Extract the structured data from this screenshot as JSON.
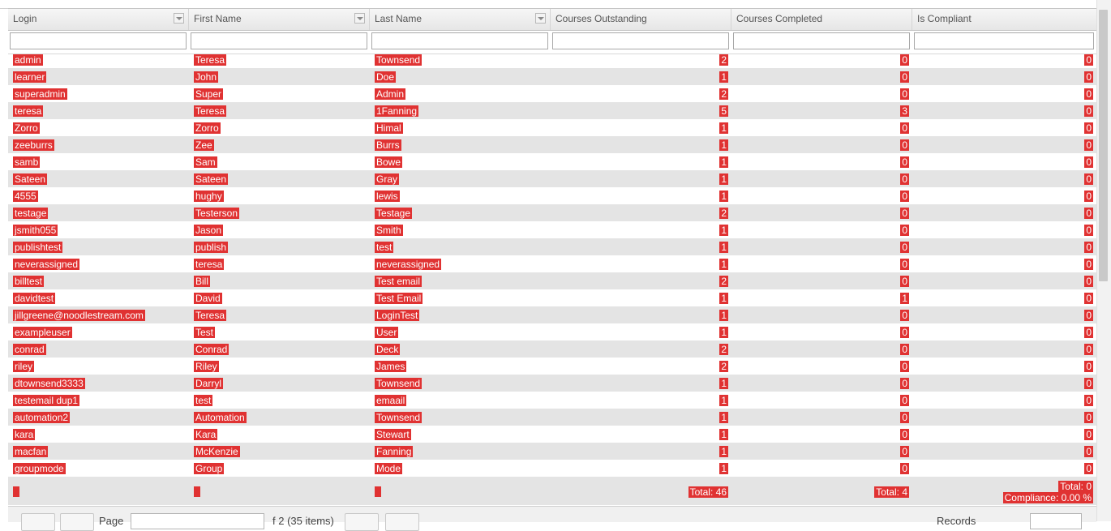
{
  "columns": [
    {
      "label": "Login",
      "has_menu": true
    },
    {
      "label": "First Name",
      "has_menu": true
    },
    {
      "label": "Last Name",
      "has_menu": true
    },
    {
      "label": "Courses Outstanding",
      "has_menu": false
    },
    {
      "label": "Courses Completed",
      "has_menu": false
    },
    {
      "label": "Is Compliant",
      "has_menu": false
    }
  ],
  "rows": [
    [
      "admin",
      "Teresa",
      "Townsend",
      "2",
      "0",
      "0"
    ],
    [
      "learner",
      "John",
      "Doe",
      "1",
      "0",
      "0"
    ],
    [
      "superadmin",
      "Super",
      "Admin",
      "2",
      "0",
      "0"
    ],
    [
      "teresa",
      "Teresa",
      "1Fanning",
      "5",
      "3",
      "0"
    ],
    [
      "Zorro",
      "Zorro",
      "Himal",
      "1",
      "0",
      "0"
    ],
    [
      "zeeburrs",
      "Zee",
      "Burrs",
      "1",
      "0",
      "0"
    ],
    [
      "samb",
      "Sam",
      "Bowe",
      "1",
      "0",
      "0"
    ],
    [
      "Sateen",
      "Sateen",
      "Gray",
      "1",
      "0",
      "0"
    ],
    [
      "4555",
      "hughy",
      "lewis",
      "1",
      "0",
      "0"
    ],
    [
      "testage",
      "Testerson",
      "Testage",
      "2",
      "0",
      "0"
    ],
    [
      "jsmith055",
      "Jason",
      "Smith",
      "1",
      "0",
      "0"
    ],
    [
      "publishtest",
      "publish",
      "test",
      "1",
      "0",
      "0"
    ],
    [
      "neverassigned",
      "teresa",
      "neverassigned",
      "1",
      "0",
      "0"
    ],
    [
      "billtest",
      "Bill",
      "Test email",
      "2",
      "0",
      "0"
    ],
    [
      "davidtest",
      "David",
      "Test Email",
      "1",
      "1",
      "0"
    ],
    [
      "jillgreene@noodlestream.com",
      "Teresa",
      "LoginTest",
      "1",
      "0",
      "0"
    ],
    [
      "exampleuser",
      "Test",
      "User",
      "1",
      "0",
      "0"
    ],
    [
      "conrad",
      "Conrad",
      "Deck",
      "2",
      "0",
      "0"
    ],
    [
      "riley",
      "Riley",
      "James",
      "2",
      "0",
      "0"
    ],
    [
      "dtownsend3333",
      "Darryl",
      "Townsend",
      "1",
      "0",
      "0"
    ],
    [
      "testemail dup1",
      "test",
      "emaail",
      "1",
      "0",
      "0"
    ],
    [
      "automation2",
      "Automation",
      "Townsend",
      "1",
      "0",
      "0"
    ],
    [
      "kara",
      "Kara",
      "Stewart",
      "1",
      "0",
      "0"
    ],
    [
      "macfan",
      "McKenzie",
      "Fanning",
      "1",
      "0",
      "0"
    ],
    [
      "groupmode",
      "Group",
      "Mode",
      "1",
      "0",
      "0"
    ]
  ],
  "footer": {
    "outstanding_total": "Total: 46",
    "completed_total": "Total: 4",
    "compliant_total": "Total: 0",
    "compliance": "Compliance: 0.00 %"
  },
  "pager": {
    "page_label": "Page",
    "of_label": "f 2 (35 items)",
    "records_label": "Records"
  },
  "colors": {
    "highlight": "#e03232",
    "alt_row": "#e4e4e4"
  }
}
